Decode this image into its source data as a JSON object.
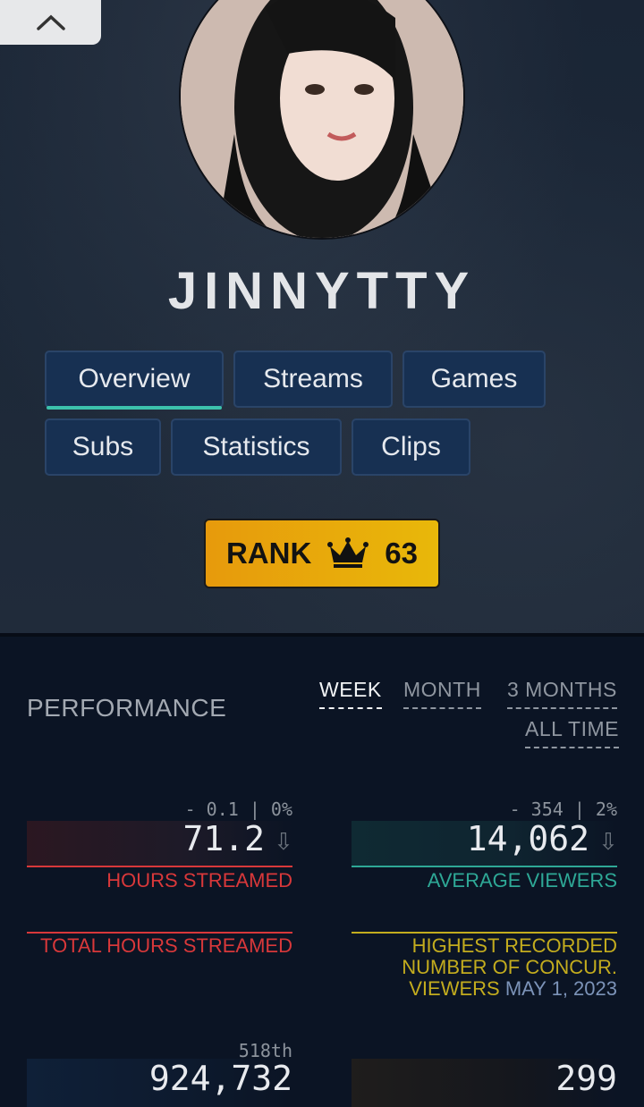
{
  "profile": {
    "name": "JINNYTTY"
  },
  "tabs": [
    {
      "label": "Overview",
      "active": true
    },
    {
      "label": "Streams",
      "active": false
    },
    {
      "label": "Games",
      "active": false
    },
    {
      "label": "Subs",
      "active": false
    },
    {
      "label": "Statistics",
      "active": false
    },
    {
      "label": "Clips",
      "active": false
    }
  ],
  "rank": {
    "label": "RANK",
    "value": "63",
    "icon": "crown-icon"
  },
  "performance": {
    "title": "PERFORMANCE",
    "periods": [
      {
        "label": "WEEK",
        "active": true
      },
      {
        "label": "MONTH",
        "active": false
      },
      {
        "label": "3 MONTHS",
        "active": false
      },
      {
        "label": "ALL TIME",
        "active": false
      }
    ],
    "hours_streamed": {
      "delta": "- 0.1 | 0%",
      "value": "71.2",
      "label": "HOURS STREAMED",
      "trend": "down"
    },
    "average_viewers": {
      "delta": "- 354 | 2%",
      "value": "14,062",
      "label": "AVERAGE VIEWERS",
      "trend": "down"
    },
    "total_hours": {
      "label": "TOTAL HOURS STREAMED",
      "rank": "518th",
      "value": "924,732"
    },
    "peak_viewers": {
      "label": "HIGHEST RECORDED NUMBER OF CONCUR. VIEWERS",
      "date": "MAY 1, 2023",
      "value": "299"
    }
  },
  "colors": {
    "accent": "#3cc1ac",
    "red": "#d8383a",
    "teal": "#2ea896",
    "yellow": "#c3ac1e",
    "rank_gold": "#e8b80a"
  }
}
